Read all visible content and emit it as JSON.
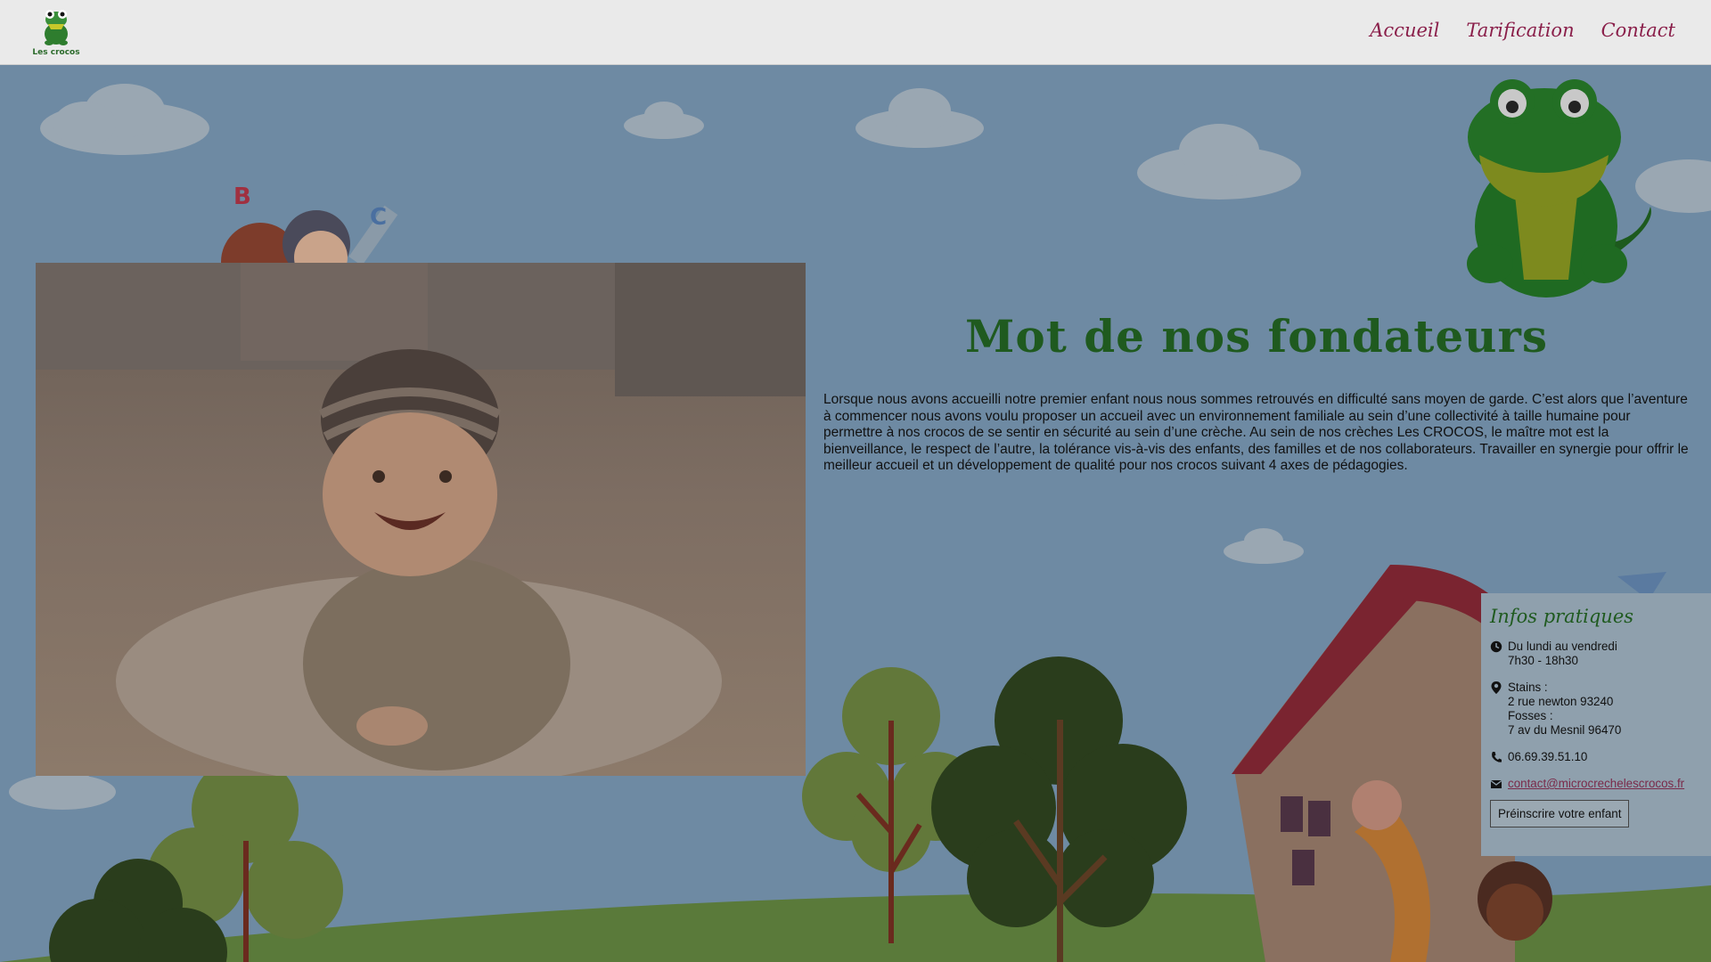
{
  "header": {
    "logo_text": "Les crocos",
    "nav": [
      "Accueil",
      "Tarification",
      "Contact"
    ]
  },
  "main": {
    "title": "Mot de nos fondateurs",
    "paragraph": "Lorsque nous avons accueilli notre premier enfant nous nous sommes retrouvés en difficulté sans moyen de garde. C’est alors que l’aventure à commencer nous avons voulu proposer un accueil avec un environnement familiale au sein d’une collectivité à taille humaine pour permettre à nos crocos de se sentir en sécurité au sein d’une crèche. Au sein de nos crèches Les CROCOS, le maître mot est la bienveillance, le respect de l’autre, la tolérance vis-à-vis des enfants, des familles et de nos collaborateurs. Travailler en synergie pour offrir le meilleur accueil et un développement de qualité pour nos crocos suivant 4 axes de pédagogies."
  },
  "infos": {
    "title": "Infos pratiques",
    "hours_line1": "Du lundi au vendredi",
    "hours_line2": "7h30 - 18h30",
    "loc1_label": "Stains :",
    "loc1_addr": "2 rue newton 93240",
    "loc2_label": "Fosses :",
    "loc2_addr": "7 av du Mesnil 96470",
    "phone": "06.69.39.51.10",
    "email": "contact@microcrechelescrocos.fr",
    "button": "Préinscrire votre enfant"
  },
  "scene_letters": [
    "B",
    "C"
  ],
  "colors": {
    "nav": "#8a1f4a",
    "title_green": "#1f5a1f",
    "sky": "#6e8aa3"
  }
}
